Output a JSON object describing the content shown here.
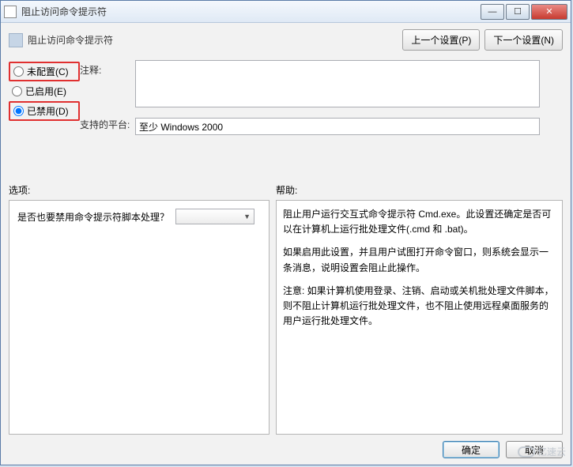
{
  "titlebar": {
    "title": "阻止访问命令提示符"
  },
  "header": {
    "title": "阻止访问命令提示符",
    "prev_btn": "上一个设置(P)",
    "next_btn": "下一个设置(N)"
  },
  "radios": {
    "not_configured": "未配置(C)",
    "enabled": "已启用(E)",
    "disabled": "已禁用(D)",
    "selected": "disabled"
  },
  "labels": {
    "comment": "注释:",
    "platform": "支持的平台:",
    "options": "选项:",
    "help": "帮助:"
  },
  "fields": {
    "comment_value": "",
    "platform_value": "至少 Windows 2000"
  },
  "options": {
    "question": "是否也要禁用命令提示符脚本处理？",
    "select_value": ""
  },
  "help": {
    "p1": "阻止用户运行交互式命令提示符 Cmd.exe。此设置还确定是否可以在计算机上运行批处理文件(.cmd 和 .bat)。",
    "p2": "如果启用此设置，并且用户试图打开命令窗口，则系统会显示一条消息，说明设置会阻止此操作。",
    "p3": "注意: 如果计算机使用登录、注销、启动或关机批处理文件脚本，则不阻止计算机运行批处理文件，也不阻止使用远程桌面服务的用户运行批处理文件。"
  },
  "footer": {
    "ok": "确定",
    "cancel": "取消"
  },
  "watermark": "亿速云"
}
